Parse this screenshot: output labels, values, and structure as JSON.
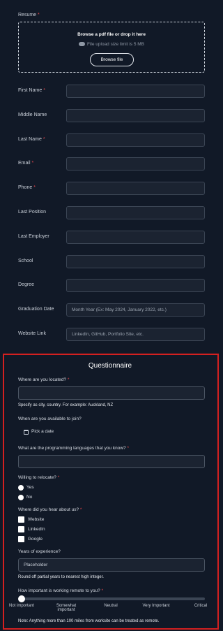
{
  "resume": {
    "label": "Resume",
    "required": "*",
    "upload_title": "Browse a pdf file or drop it here",
    "upload_limit": "File upload size limit is 5 MB",
    "browse_label": "Browse file"
  },
  "fields": [
    {
      "label": "First Name",
      "required": "*",
      "placeholder": ""
    },
    {
      "label": "Middle Name",
      "required": "",
      "placeholder": ""
    },
    {
      "label": "Last Name",
      "required": "*",
      "placeholder": ""
    },
    {
      "label": "Email",
      "required": "*",
      "placeholder": ""
    },
    {
      "label": "Phone",
      "required": "*",
      "placeholder": ""
    },
    {
      "label": "Last Position",
      "required": "",
      "placeholder": ""
    },
    {
      "label": "Last Employer",
      "required": "",
      "placeholder": ""
    },
    {
      "label": "School",
      "required": "",
      "placeholder": ""
    },
    {
      "label": "Degree",
      "required": "",
      "placeholder": ""
    },
    {
      "label": "Graduation Date",
      "required": "",
      "placeholder": "Month Year (Ex: May 2024, January 2022, etc.)"
    },
    {
      "label": "Website Link",
      "required": "",
      "placeholder": "LinkedIn, GitHub, Portfolio Site, etc."
    }
  ],
  "questionnaire": {
    "title": "Questionnaire",
    "location": {
      "label": "Where are you located?",
      "required": "*",
      "hint": "Specify as city, country. For example: Auckland, NZ"
    },
    "availability": {
      "label": "When are you available to join?",
      "pick_label": "Pick a date"
    },
    "languages": {
      "label": "What are the programming languages that you know?",
      "required": "*"
    },
    "relocate": {
      "label": "Willing to relocate?",
      "required": "*",
      "options": [
        "Yes",
        "No"
      ]
    },
    "hear": {
      "label": "Where did you hear about us?",
      "required": "*",
      "options": [
        "Website",
        "LinkedIn",
        "Google"
      ]
    },
    "experience": {
      "label": "Years of experience?",
      "placeholder": "Placeholder",
      "hint": "Round off partial years to nearest high integer."
    },
    "remote": {
      "label": "How important is working remote to you?",
      "required": "*",
      "value_index": 0,
      "ticks": [
        "Not important",
        "Somewhat important",
        "Neutral",
        "Very Important",
        "Critical"
      ],
      "note": "Note: Anything more than 100 miles from worksite can be treated as remote."
    }
  },
  "colors": {
    "background": "#111927",
    "required": "#e5484d",
    "highlight_border": "#d42020"
  }
}
